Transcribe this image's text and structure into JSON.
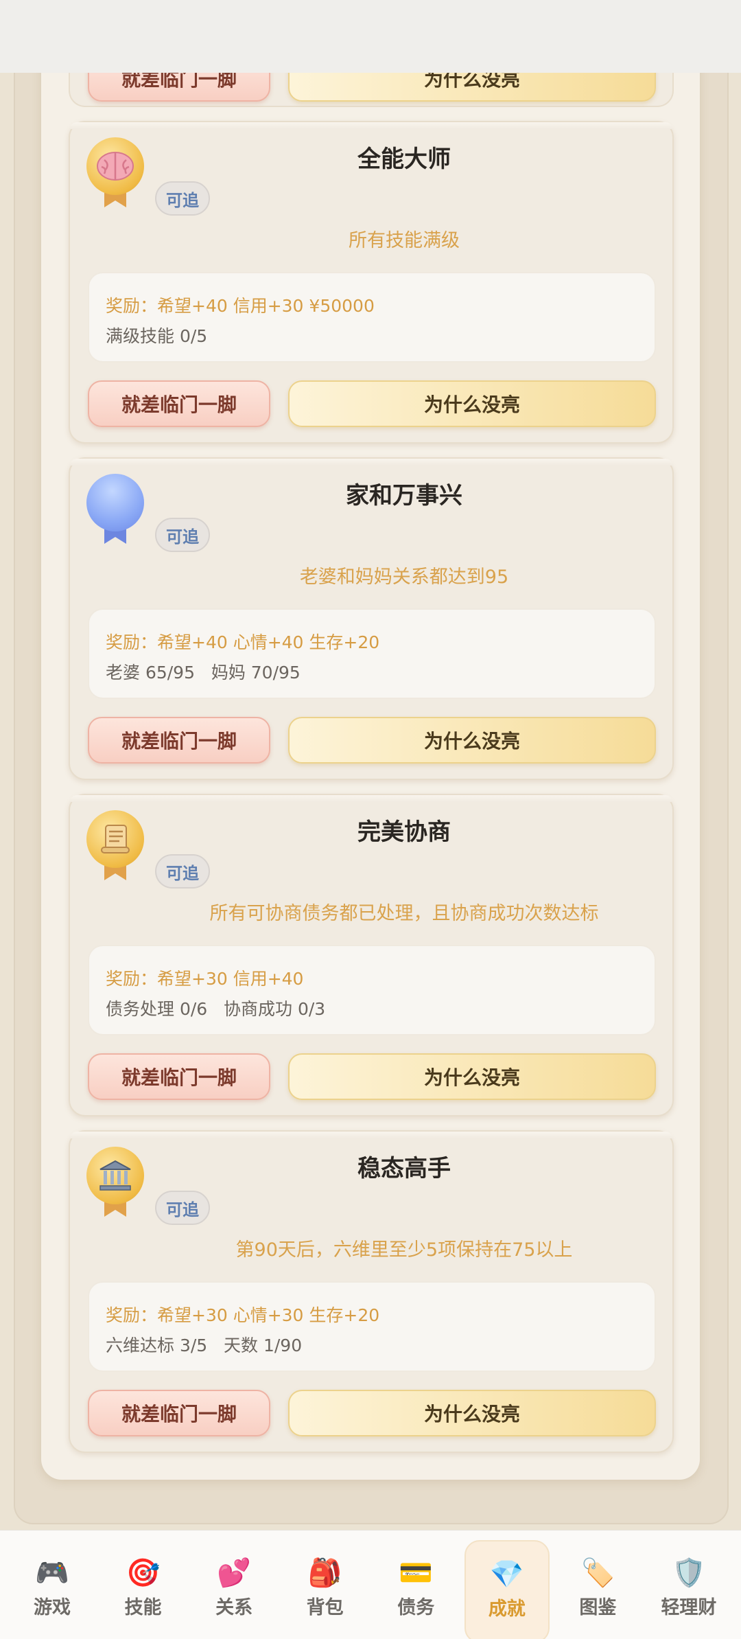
{
  "cards": [
    {
      "title": "全能大师",
      "tag": "可追",
      "description": "所有技能满级",
      "reward": "奖励：希望+40 信用+30 ¥50000",
      "progress": "满级技能 0/5",
      "icon": "brain-icon",
      "near_button": "就差临门一脚",
      "why_button": "为什么没亮"
    },
    {
      "title": "家和万事兴",
      "tag": "可追",
      "description": "老婆和妈妈关系都达到95",
      "reward": "奖励：希望+40 心情+40 生存+20",
      "progress": "老婆 65/95   妈妈 70/95",
      "icon": "blue-medal-icon",
      "near_button": "就差临门一脚",
      "why_button": "为什么没亮"
    },
    {
      "title": "完美协商",
      "tag": "可追",
      "description": "所有可协商债务都已处理，且协商成功次数达标",
      "reward": "奖励：希望+30 信用+40",
      "progress": "债务处理 0/6   协商成功 0/3",
      "icon": "scroll-icon",
      "near_button": "就差临门一脚",
      "why_button": "为什么没亮"
    },
    {
      "title": "稳态高手",
      "tag": "可追",
      "description": "第90天后，六维里至少5项保持在75以上",
      "reward": "奖励：希望+30 心情+30 生存+20",
      "progress": "六维达标 3/5   天数 1/90",
      "icon": "bank-icon",
      "near_button": "就差临门一脚",
      "why_button": "为什么没亮"
    }
  ],
  "nav": [
    {
      "label": "游戏",
      "icon": "gamepad-icon",
      "glyph": "🎮"
    },
    {
      "label": "技能",
      "icon": "target-icon",
      "glyph": "🎯"
    },
    {
      "label": "关系",
      "icon": "hearts-icon",
      "glyph": "💕"
    },
    {
      "label": "背包",
      "icon": "backpack-icon",
      "glyph": "🎒"
    },
    {
      "label": "债务",
      "icon": "credit-card-icon",
      "glyph": "💳"
    },
    {
      "label": "成就",
      "icon": "gem-icon",
      "glyph": "💎",
      "active": true
    },
    {
      "label": "图鉴",
      "icon": "tag-icon",
      "glyph": "🏷️"
    },
    {
      "label": "轻理财",
      "icon": "shield-icon",
      "glyph": "🛡️"
    }
  ],
  "colors": {
    "accent": "#d99a2f",
    "reward_text": "#d69c43",
    "tag_text": "#5f7fb0"
  }
}
